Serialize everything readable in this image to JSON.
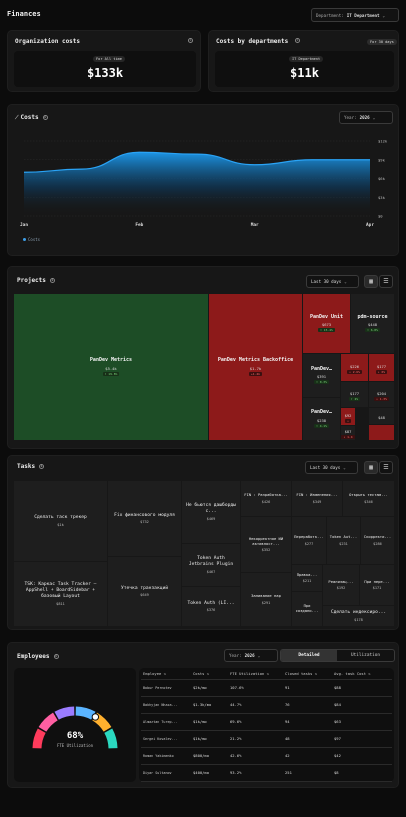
{
  "page": {
    "title": "Finances",
    "department_label": "Department:",
    "department_value": "IT Department"
  },
  "org_costs": {
    "title": "Organization costs",
    "period": "For All time",
    "value": "$133k"
  },
  "dept_costs": {
    "title": "Costs by departments",
    "badge": "For 30 days",
    "period": "IT Department",
    "value": "$11k"
  },
  "costs_chart": {
    "title": "Costs",
    "year_label": "Year:",
    "year_value": "2026",
    "legend": "Costs"
  },
  "chart_data": {
    "type": "area",
    "x": [
      "Jan",
      "Feb",
      "Mar",
      "Apr"
    ],
    "y_ticks": [
      "$12k",
      "$9k",
      "$6k",
      "$3k",
      "$0"
    ],
    "ylim": [
      0,
      12000
    ],
    "series": [
      {
        "name": "Costs",
        "values": [
          {
            "x": "Jan",
            "y": 7000
          },
          {
            "x": "Jan 15",
            "y": 7500
          },
          {
            "x": "Feb",
            "y": 10200
          },
          {
            "x": "Feb 15",
            "y": 9900
          },
          {
            "x": "Mar",
            "y": 8200
          },
          {
            "x": "Mar 15",
            "y": 9000
          },
          {
            "x": "Apr",
            "y": 9000
          }
        ]
      }
    ],
    "grid": true,
    "legend_position": "bottom-left"
  },
  "projects": {
    "title": "Projects",
    "range": "Last 30 days",
    "items": [
      {
        "name": "PanDev Metrics",
        "value": "$5.4k",
        "delta": "↑ 19.8%",
        "color": "#1d4d26",
        "up": true
      },
      {
        "name": "PanDev Metrics Backoffice",
        "value": "$1.7k",
        "delta": "+1.4k",
        "color": "#8d1a1a",
        "up": false
      },
      {
        "name": "PanDev Unit",
        "value": "$673",
        "delta": "↑ 15.4%",
        "color": "#8d1a1a",
        "up": true
      },
      {
        "name": "pdm-source",
        "value": "$448",
        "delta": "↑ 6.8%",
        "color": "#1e1e1e",
        "up": true
      },
      {
        "name": "PanDev…",
        "value": "$391",
        "delta": "↑ 0.3%",
        "color": "#1e1e1e",
        "up": true
      },
      {
        "name": "PanDev…",
        "value": "$238",
        "delta": "↑ 4.1%",
        "color": "#1e1e1e",
        "up": true
      },
      {
        "name": "",
        "value": "$226",
        "delta": "↓ 2.6%",
        "color": "#8d1a1a",
        "up": false
      },
      {
        "name": "",
        "value": "$177",
        "delta": "↑ 2%",
        "color": "#1e1e1e",
        "up": true
      },
      {
        "name": "",
        "value": "$204",
        "delta": "↓ 1.3%",
        "color": "#1e1e1e",
        "up": false
      },
      {
        "name": "",
        "value": "$177",
        "delta": "↓ 6%",
        "color": "#8d1a1a",
        "up": false
      },
      {
        "name": "",
        "value": "$92",
        "delta": "↓",
        "color": "#8d1a1a",
        "up": false
      },
      {
        "name": "",
        "value": "$87",
        "delta": "↓ 1.4",
        "color": "#1e1e1e",
        "up": false
      },
      {
        "name": "",
        "value": "$48",
        "delta": "",
        "color": "#1e1e1e",
        "up": false
      },
      {
        "name": "",
        "value": "",
        "delta": "",
        "color": "#8d1a1a",
        "up": false
      }
    ]
  },
  "tasks": {
    "title": "Tasks",
    "range": "Last 30 days",
    "items": [
      {
        "name": "Сделать таск трекер",
        "value": "$1k"
      },
      {
        "name": "TSK: Каркас Task Tracker — AppShell + BoardSidebar + базовый Layout",
        "value": "$811"
      },
      {
        "name": "Fix финансового модуля",
        "value": "$732"
      },
      {
        "name": "Утечка транзакций",
        "value": "$649"
      },
      {
        "name": "Не бьются дашборды с...",
        "value": "$469"
      },
      {
        "name": "Token Auth Jetbrains Plugin",
        "value": "$467"
      },
      {
        "name": "Token Auth (LI...",
        "value": "$376"
      },
      {
        "name": "FIN : Разработка...",
        "value": "$426"
      },
      {
        "name": "Некорректное ИИ активност...",
        "value": "$352"
      },
      {
        "name": "Заливание пар",
        "value": "$291"
      },
      {
        "name": "FIN : Изменения...",
        "value": "$349"
      },
      {
        "name": "Открыть тестам...",
        "value": "$346"
      },
      {
        "name": "Переработк...",
        "value": "$277"
      },
      {
        "name": "Token Aut...",
        "value": "$231"
      },
      {
        "name": "Скорректи...",
        "value": "$286"
      },
      {
        "name": "Правка...",
        "value": "$211"
      },
      {
        "name": "При создани...",
        "value": ""
      },
      {
        "name": "Реализац...",
        "value": "$192"
      },
      {
        "name": "При пере...",
        "value": "$171"
      },
      {
        "name": "Сделать индексиро...",
        "value": "$178"
      }
    ]
  },
  "employees": {
    "title": "Employees",
    "year_label": "Year:",
    "year_value": "2026",
    "tab_detailed": "Detailed",
    "tab_utilization": "Utilization",
    "gauge": {
      "percent": "68%",
      "label": "FTE Utilization",
      "value": 0.68
    },
    "columns": [
      "Employee",
      "Costs",
      "FTE Utilization",
      "Closed tasks",
      "Avg. task Cost"
    ],
    "rows": [
      [
        "Bobur Pernotev",
        "$2k/mo",
        "107.6%",
        "91",
        "$88"
      ],
      [
        "Bakhyjan Nhaza...",
        "$1.3k/mo",
        "44.7%",
        "76",
        "$84"
      ],
      [
        "Almaztan Turep...",
        "$1k/mo",
        "69.6%",
        "94",
        "$63"
      ],
      [
        "Sergei Kovalev...",
        "$1k/mo",
        "21.2%",
        "48",
        "$97"
      ],
      [
        "Roman Yakimenko",
        "$800/mo",
        "42.6%",
        "42",
        "$42"
      ],
      [
        "Diyar Sultanov",
        "$400/mo",
        "93.2%",
        "251",
        "$8"
      ]
    ]
  },
  "colors": {
    "bg": "#0c0c0c",
    "card": "#171717",
    "area_top": "#1a8fe0",
    "green": "#1d4d26",
    "red": "#8d1a1a"
  }
}
